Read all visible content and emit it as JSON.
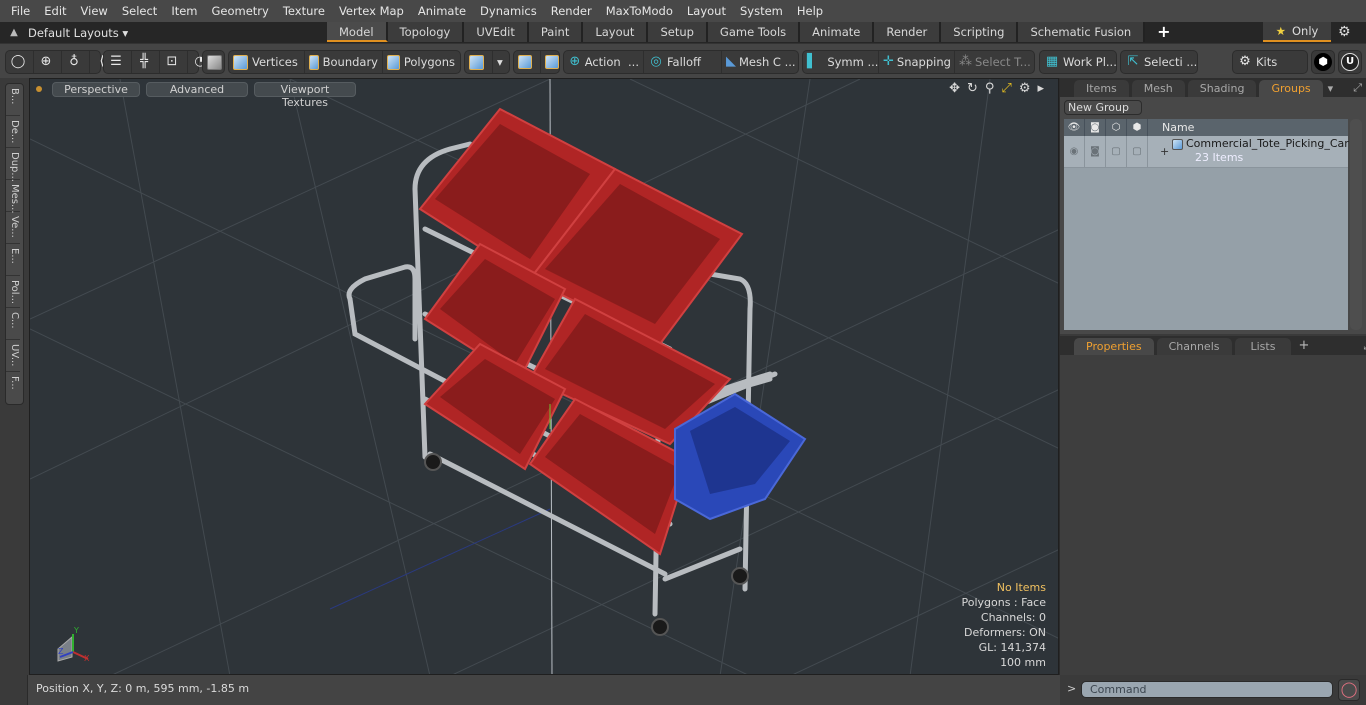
{
  "menu": [
    "File",
    "Edit",
    "View",
    "Select",
    "Item",
    "Geometry",
    "Texture",
    "Vertex Map",
    "Animate",
    "Dynamics",
    "Render",
    "MaxToModo",
    "Layout",
    "System",
    "Help"
  ],
  "layout_bar": {
    "layouts_label": "Default Layouts",
    "tabs": [
      "Model",
      "Topology",
      "UVEdit",
      "Paint",
      "Layout",
      "Setup",
      "Game Tools",
      "Animate",
      "Render",
      "Scripting",
      "Schematic Fusion"
    ],
    "active_tab": "Model",
    "add_tab": "+",
    "only_label": "Only"
  },
  "toolbar": {
    "vertices": "Vertices",
    "boundary": "Boundary",
    "polygons": "Polygons",
    "action": "Action",
    "falloff": "Falloff",
    "mesh_c": "Mesh C ...",
    "symm": "Symm ...",
    "snapping": "Snapping",
    "select_t": "Select T...",
    "work_pl": "Work Pl...",
    "selecti": "Selecti ...",
    "kits": "Kits",
    "ellipsis": "..."
  },
  "side_tabs": [
    "B...",
    "De...",
    "Dup...",
    "Mes...",
    "Ve...",
    "E...",
    "Pol...",
    "C...",
    "UV...",
    "F..."
  ],
  "viewport": {
    "view_label": "Perspective",
    "shading_label": "Advanced",
    "textures_label": "Viewport Textures",
    "stats": {
      "selection": "No Items",
      "polygons": "Polygons : Face",
      "channels": "Channels: 0",
      "deformers": "Deformers: ON",
      "gl": "GL: 141,374",
      "grid": "100 mm"
    },
    "axis": {
      "x": "X",
      "y": "Y",
      "z": "Z"
    }
  },
  "status": {
    "position": "Position X, Y, Z:   0 m, 595 mm, -1.85 m"
  },
  "groups_panel": {
    "tabs": [
      "Items",
      "Mesh ...",
      "Shading",
      "Groups"
    ],
    "active_tab": "Groups",
    "new_group": "New Group",
    "name_header": "Name",
    "rows": [
      {
        "name": "Commercial_Tote_Picking_Car ...",
        "count": "23 Items",
        "expander": "+"
      }
    ]
  },
  "properties_panel": {
    "tabs": [
      "Properties",
      "Channels",
      "Lists"
    ],
    "active_tab": "Properties",
    "add_tab": "+"
  },
  "command": {
    "prompt": ">",
    "placeholder": "Command"
  }
}
